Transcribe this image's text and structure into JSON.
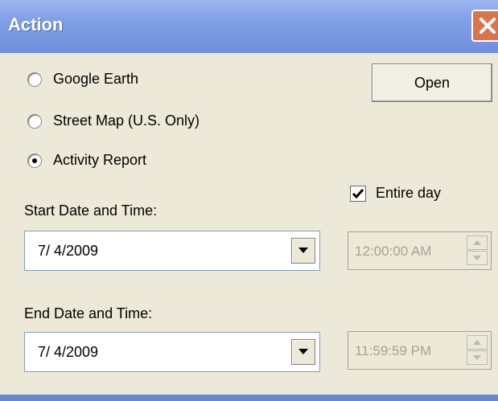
{
  "window": {
    "title": "Action"
  },
  "options": [
    {
      "label": "Google Earth",
      "checked": false
    },
    {
      "label": "Street Map (U.S. Only)",
      "checked": false
    },
    {
      "label": "Activity Report",
      "checked": true
    }
  ],
  "open_button": {
    "label": "Open"
  },
  "entire_day": {
    "label": "Entire day",
    "checked": true
  },
  "start": {
    "label": "Start Date and Time:",
    "date": "7/  4/2009",
    "time": "12:00:00 AM"
  },
  "end": {
    "label": "End Date and Time:",
    "date": "7/  4/2009",
    "time": "11:59:59 PM"
  },
  "icons": {
    "close": "close-icon",
    "dropdown": "chevron-down-icon",
    "spin_up": "triangle-up-icon",
    "spin_down": "triangle-down-icon",
    "check": "checkmark-icon"
  },
  "colors": {
    "titlebar": "#7f9fe6",
    "close_button": "#d9744f",
    "window_bg": "#ece9d8",
    "disabled_text": "#a5a296"
  }
}
